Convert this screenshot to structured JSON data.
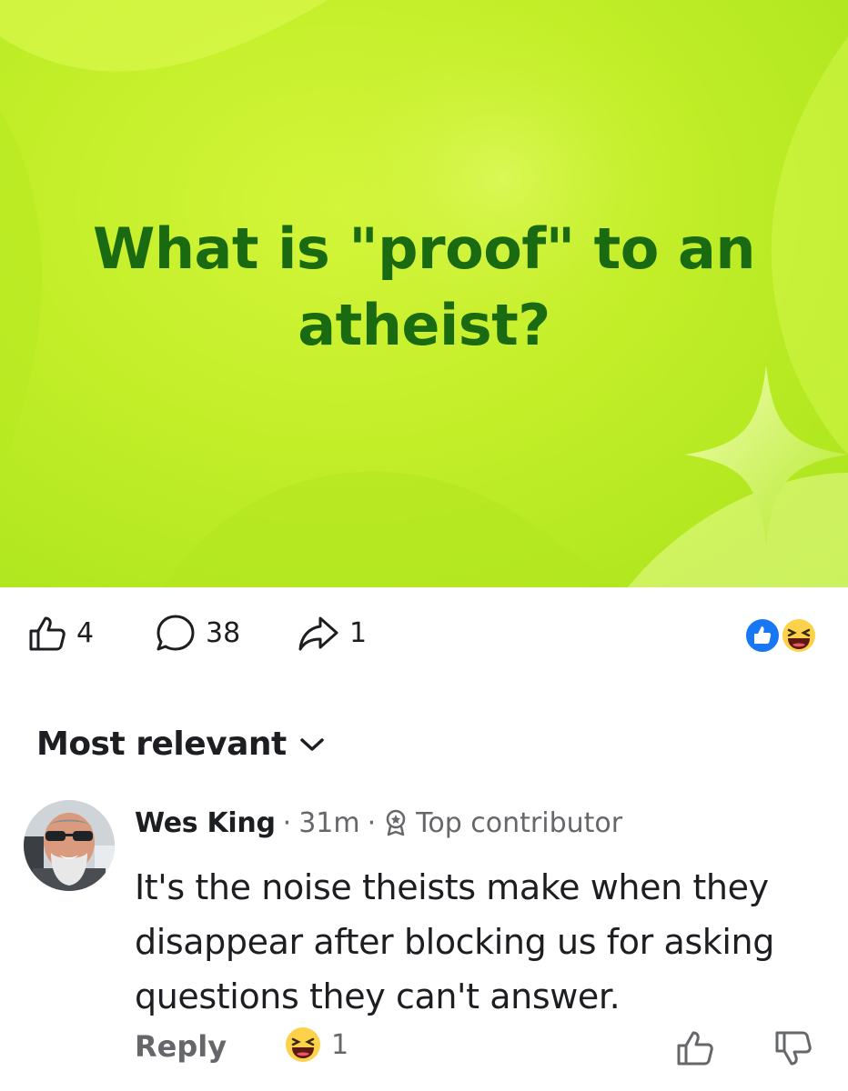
{
  "post": {
    "title": "What is \"proof\" to an atheist?",
    "background_color": "#c2ee28",
    "title_color": "#1a6a12"
  },
  "stats": {
    "likes": "4",
    "comments": "38",
    "shares": "1",
    "reactions": [
      "like-reaction-icon",
      "haha-reaction-icon"
    ]
  },
  "sort": {
    "label": "Most relevant"
  },
  "comment": {
    "author": "Wes King",
    "separator": "·",
    "time": "31m",
    "badge": "Top contributor",
    "text": "It's the noise theists make when they disappear after blocking us for asking questions they can't answer.",
    "reply_label": "Reply",
    "reaction_count": "1"
  }
}
